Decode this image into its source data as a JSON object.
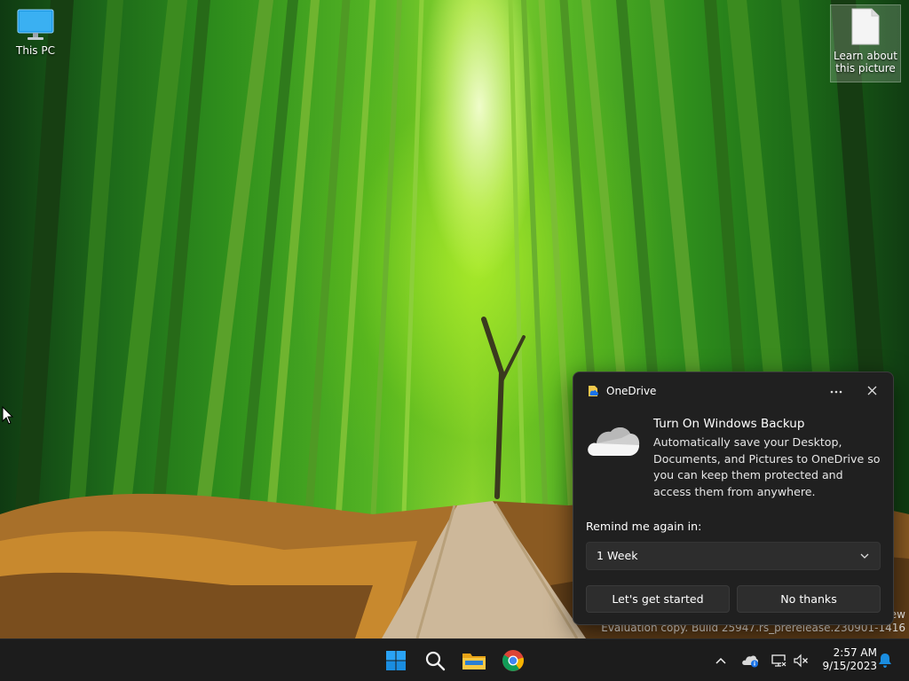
{
  "desktop": {
    "icons": [
      {
        "label": "This PC",
        "icon": "monitor-icon"
      },
      {
        "label": "Learn about this picture",
        "icon": "document-icon"
      }
    ],
    "watermark": {
      "line1": "ew",
      "line2": "Evaluation copy. Build 25947.rs_prerelease.230901-1416"
    }
  },
  "onedrive_flyout": {
    "app_name": "OneDrive",
    "more_icon": "more-horizontal-icon",
    "close_icon": "close-icon",
    "title": "Turn On Windows Backup",
    "body": "Automatically save your Desktop, Documents, and Pictures to OneDrive so you can keep them protected and access them from anywhere.",
    "remind_label": "Remind me again in:",
    "remind_selected": "1 Week",
    "primary_button": "Let's get started",
    "secondary_button": "No thanks"
  },
  "taskbar": {
    "apps": [
      {
        "name": "Start",
        "icon": "windows-start-icon"
      },
      {
        "name": "Search",
        "icon": "search-icon"
      },
      {
        "name": "File Explorer",
        "icon": "folder-icon"
      },
      {
        "name": "Google Chrome",
        "icon": "chrome-icon"
      }
    ],
    "tray": {
      "chevron_icon": "chevron-up-icon",
      "onedrive_icon": "onedrive-cloud-icon",
      "network_icon": "network-icon",
      "volume_icon": "volume-muted-icon",
      "time": "2:57 AM",
      "date": "9/15/2023",
      "notification_icon": "bell-icon"
    }
  },
  "colors": {
    "flyout_bg": "#202020",
    "button_bg": "#2d2d2d",
    "taskbar_bg": "#1c1c1c",
    "accent": "#0a84ff"
  }
}
